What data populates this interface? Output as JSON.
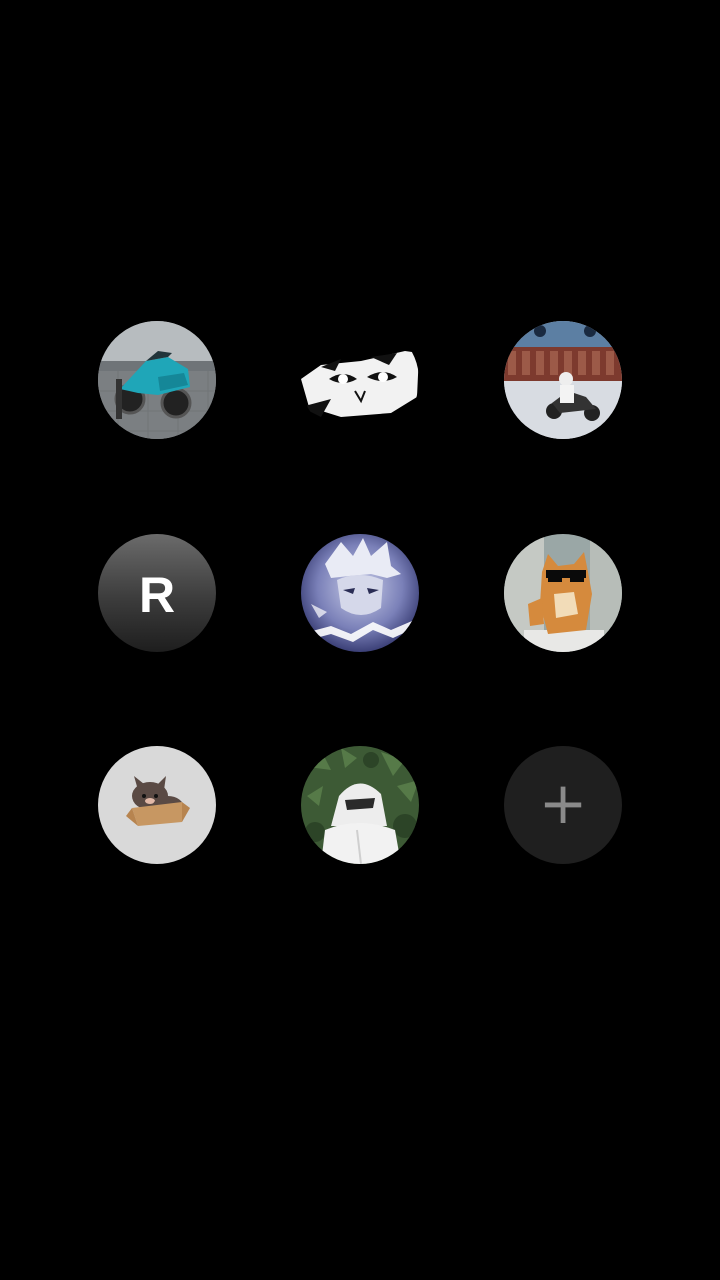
{
  "profiles": [
    {
      "kind": "photo",
      "icon": "motorcycle-photo"
    },
    {
      "kind": "photo",
      "icon": "anime-eyes-photo"
    },
    {
      "kind": "photo",
      "icon": "scooter-photo"
    },
    {
      "kind": "letter",
      "letter": "R",
      "icon": "letter-avatar"
    },
    {
      "kind": "photo",
      "icon": "anime-lightning-photo"
    },
    {
      "kind": "photo",
      "icon": "cat-sunglasses-photo"
    },
    {
      "kind": "photo",
      "icon": "cat-in-box-photo"
    },
    {
      "kind": "photo",
      "icon": "hooded-person-photo"
    },
    {
      "kind": "add",
      "symbol": "+",
      "icon": "plus-icon"
    }
  ],
  "colors": {
    "background": "#000000",
    "add_button_bg": "#1f1f1f",
    "add_button_fg": "#8a8a8a",
    "letter_avatar_top": "#6b6b6b",
    "letter_avatar_bottom": "#1e1e1e",
    "cat_avatar_bg": "#d9d9d9"
  }
}
